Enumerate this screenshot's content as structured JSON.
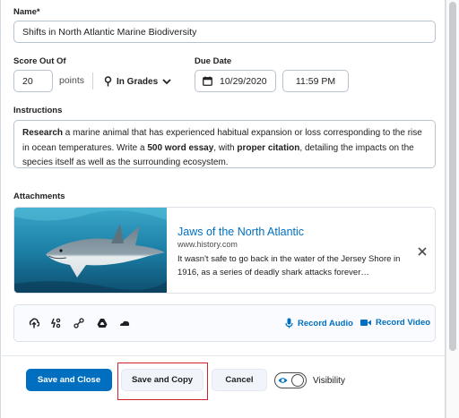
{
  "form": {
    "name_label": "Name",
    "name_required": "*",
    "name_value": "Shifts in North Atlantic Marine Biodiversity",
    "score_label": "Score Out Of",
    "score_value": "20",
    "points_text": "points",
    "grades_label": "In Grades",
    "due_date_label": "Due Date",
    "due_date_value": "10/29/2020",
    "due_time_value": "11:59 PM",
    "instructions_label": "Instructions",
    "instructions": {
      "p1": "Research",
      "p2": " a marine animal that has experienced habitual expansion or loss corresponding to the rise in ocean temperatures. Write a ",
      "p3": "500 word essay",
      "p4": ", with ",
      "p5": "proper citation",
      "p6": ", detailing the impacts on the species itself as well as the surrounding ecosystem."
    },
    "attachments_label": "Attachments"
  },
  "attachment": {
    "title": "Jaws of the North Atlantic",
    "url": "www.history.com",
    "description": "It wasn't safe to go back in the water of the Jersey Shore in 1916, as a series of deadly shark attacks forever…",
    "close_icon": "close-icon"
  },
  "toolbar": {
    "icons": [
      "upload-icon",
      "link-icon",
      "share-icon",
      "google-drive-icon",
      "onedrive-icon"
    ],
    "record_audio": "Record Audio",
    "record_video": "Record Video"
  },
  "footer": {
    "save_close": "Save and Close",
    "save_copy": "Save and Copy",
    "cancel": "Cancel",
    "visibility": "Visibility",
    "visibility_on": true
  },
  "colors": {
    "accent": "#006fbf",
    "highlight": "#d1222b"
  }
}
